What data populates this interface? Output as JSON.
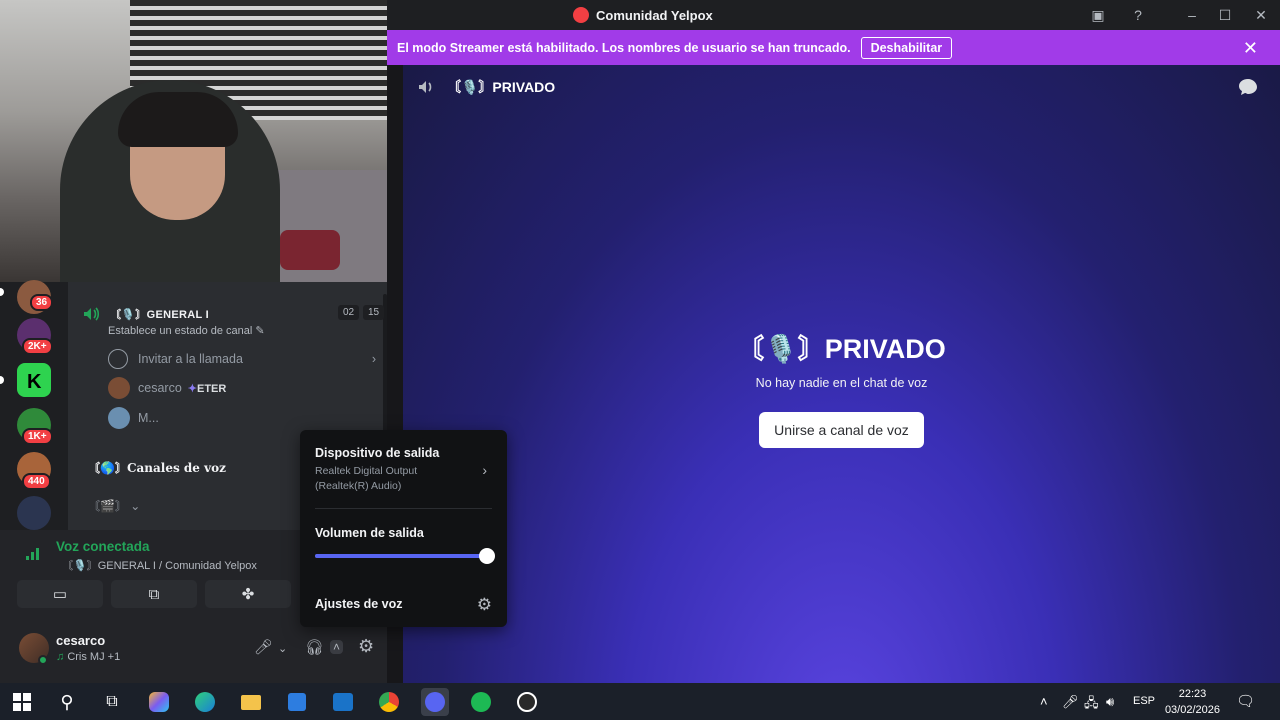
{
  "window": {
    "title": "Comunidad Yelpox"
  },
  "banner": {
    "message": "El modo Streamer está habilitado. Los nombres de usuario se han truncado.",
    "button_label": "Deshabilitar"
  },
  "main": {
    "channel_name": "〘🎙️〙PRIVADO",
    "empty_text": "No hay nadie en el chat de voz",
    "join_button": "Unirse a canal de voz"
  },
  "servers": [
    {
      "icon": "server-icon",
      "badge": "36",
      "color": "#8b5a40"
    },
    {
      "icon": "server-icon",
      "badge": "2K+",
      "color": "#5b2f6e"
    },
    {
      "icon": "kick-icon",
      "badge": "",
      "color": "#2ed34f"
    },
    {
      "icon": "server-icon",
      "badge": "1K+",
      "color": "#2f8a3a"
    },
    {
      "icon": "server-icon",
      "badge": "440",
      "color": "#a8643a"
    },
    {
      "icon": "server-icon",
      "badge": "",
      "color": "#2b3550"
    }
  ],
  "channels": {
    "voice_channel": "〘🎙️〙GENERAL I",
    "count_a": "02",
    "count_b": "15",
    "set_status": "Establece un estado de canal",
    "invite_label": "Invitar a la llamada",
    "members": [
      {
        "name": "cesarco",
        "tag": "ETER"
      },
      {
        "name": "M...",
        "tag": ""
      }
    ],
    "category": "〘🌎〙Canales de voz",
    "category2": "〘🎬〙"
  },
  "voice_panel": {
    "status": "Voz conectada",
    "location": "〘🎙️〙GENERAL I / Comunidad Yelpox"
  },
  "user": {
    "name": "cesarco",
    "activity": "Cris MJ +1"
  },
  "popup": {
    "output_device_title": "Dispositivo de salida",
    "output_device_name": "Realtek Digital Output (Realtek(R) Audio)",
    "volume_title": "Volumen de salida",
    "volume_fraction": 1.0,
    "settings_label": "Ajustes de voz"
  },
  "taskbar": {
    "language": "ESP",
    "time": "22:23",
    "date": "03/02/2026"
  },
  "colors": {
    "accent": "#5865f2",
    "banner": "#a13be8",
    "online": "#23a559"
  }
}
